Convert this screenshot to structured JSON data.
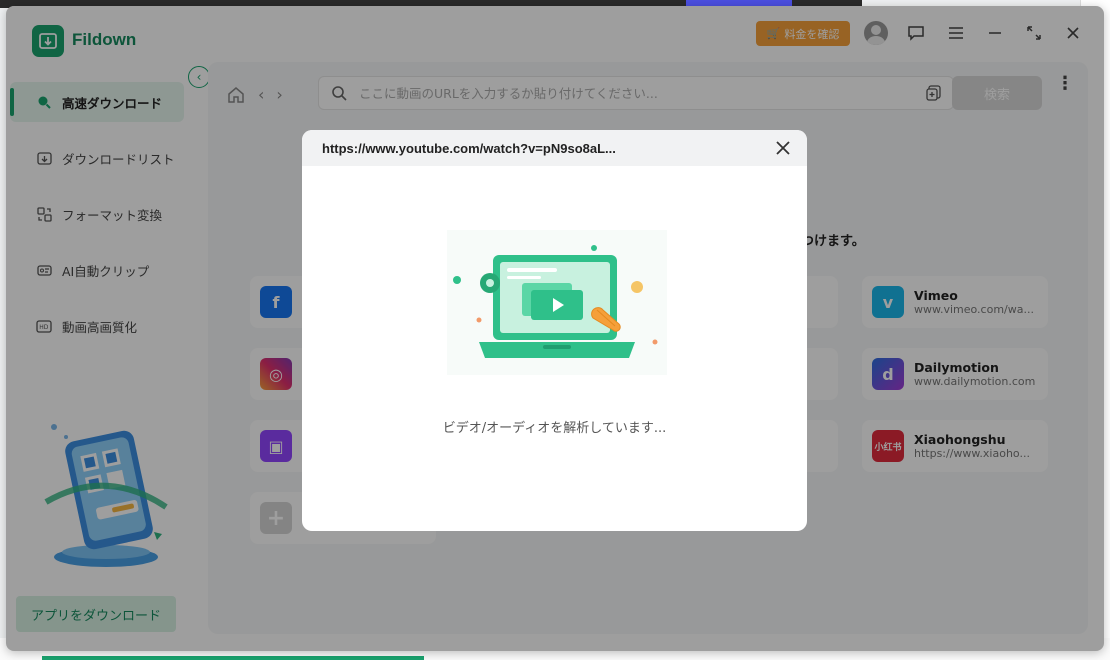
{
  "app": {
    "brand": "Fildown",
    "price_button": "料金を確認"
  },
  "sidebar": {
    "items": [
      {
        "label": "高速ダウンロード",
        "icon": "search-icon"
      },
      {
        "label": "ダウンロードリスト",
        "icon": "download-list-icon"
      },
      {
        "label": "フォーマット変換",
        "icon": "convert-icon"
      },
      {
        "label": "AI自動クリップ",
        "icon": "clip-icon"
      },
      {
        "label": "動画高画質化",
        "icon": "hd-icon"
      }
    ],
    "download_app": "アプリをダウンロード"
  },
  "search": {
    "placeholder": "ここに動画のURLを入力するか貼り付けてください...",
    "button": "検索"
  },
  "main": {
    "find_text": "見つけます。",
    "sites": [
      {
        "name": "Vimeo",
        "url": "www.vimeo.com/wa...",
        "color": "#1ab7ea",
        "icon": "vimeo-logo"
      },
      {
        "name": "Dailymotion",
        "url": "www.dailymotion.com",
        "color": "#7a33d6",
        "icon": "dailymotion-logo"
      },
      {
        "name": "Xiaohongshu",
        "url": "https://www.xiaoho...",
        "color": "#e02a3c",
        "icon": "xiaohongshu-logo"
      }
    ],
    "left_site_colors": [
      "#1877f2",
      "#e1306c",
      "#9146ff",
      "#cccccc"
    ]
  },
  "modal": {
    "url": "https://www.youtube.com/watch?v=pN9so8aL...",
    "status": "ビデオ/オーディオを解析しています..."
  }
}
